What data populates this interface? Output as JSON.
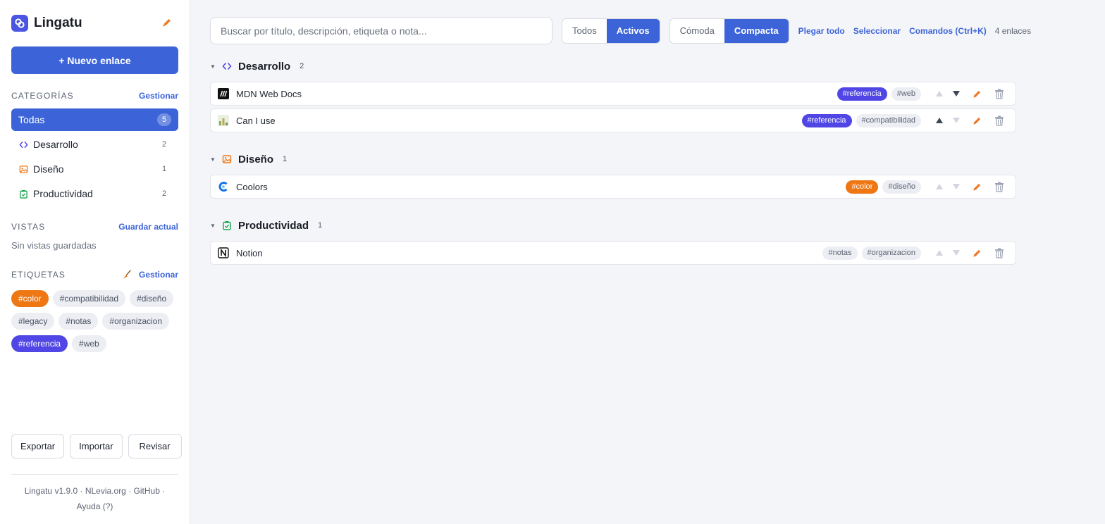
{
  "app": {
    "name": "Lingatu"
  },
  "colors": {
    "accent": "#3c64d8",
    "brand": "#4a56e2",
    "referencia": "#5046e5",
    "color_tag": "#ee7613",
    "edit": "#f07a2c",
    "text": "#1f2430"
  },
  "sidebar": {
    "new_link_label": "+ Nuevo enlace",
    "categories": {
      "title": "CATEGORÍAS",
      "manage_label": "Gestionar",
      "items": [
        {
          "label": "Todas",
          "count": "5",
          "icon": "none",
          "active": true
        },
        {
          "label": "Desarrollo",
          "count": "2",
          "icon": "code-icon"
        },
        {
          "label": "Diseño",
          "count": "1",
          "icon": "image-icon"
        },
        {
          "label": "Productividad",
          "count": "2",
          "icon": "clipboard-check-icon"
        }
      ]
    },
    "views": {
      "title": "VISTAS",
      "save_label": "Guardar actual",
      "empty_text": "Sin vistas guardadas"
    },
    "tags": {
      "title": "ETIQUETAS",
      "manage_label": "Gestionar",
      "items": [
        "#color",
        "#compatibilidad",
        "#diseño",
        "#legacy",
        "#notas",
        "#organizacion",
        "#referencia",
        "#web"
      ]
    },
    "footer": {
      "export_label": "Exportar",
      "import_label": "Importar",
      "review_label": "Revisar",
      "version": "Lingatu v1.9.0",
      "site": "NLevia.org",
      "github": "GitHub",
      "help": "Ayuda (?)",
      "sep": "·"
    }
  },
  "toolbar": {
    "search_placeholder": "Buscar por título, descripción, etiqueta o nota...",
    "filter": {
      "all": "Todos",
      "active": "Activos",
      "selected": "Activos"
    },
    "density": {
      "comfortable": "Cómoda",
      "compact": "Compacta",
      "selected": "Compacta"
    },
    "collapse_all": "Plegar todo",
    "select": "Seleccionar",
    "commands": "Comandos (Ctrl+K)",
    "link_count": "4 enlaces"
  },
  "groups": [
    {
      "name": "Desarrollo",
      "count": "2",
      "icon": "code-icon",
      "links": [
        {
          "title": "MDN Web Docs",
          "favicon": "mdn-favicon",
          "tags": [
            "#referencia",
            "#web"
          ]
        },
        {
          "title": "Can I use",
          "favicon": "caniuse-favicon",
          "tags": [
            "#referencia",
            "#compatibilidad"
          ]
        }
      ]
    },
    {
      "name": "Diseño",
      "count": "1",
      "icon": "image-icon",
      "links": [
        {
          "title": "Coolors",
          "favicon": "coolors-favicon",
          "tags": [
            "#color",
            "#diseño"
          ]
        }
      ]
    },
    {
      "name": "Productividad",
      "count": "1",
      "icon": "clipboard-check-icon",
      "links": [
        {
          "title": "Notion",
          "favicon": "notion-favicon",
          "tags": [
            "#notas",
            "#organizacion"
          ]
        }
      ]
    }
  ]
}
